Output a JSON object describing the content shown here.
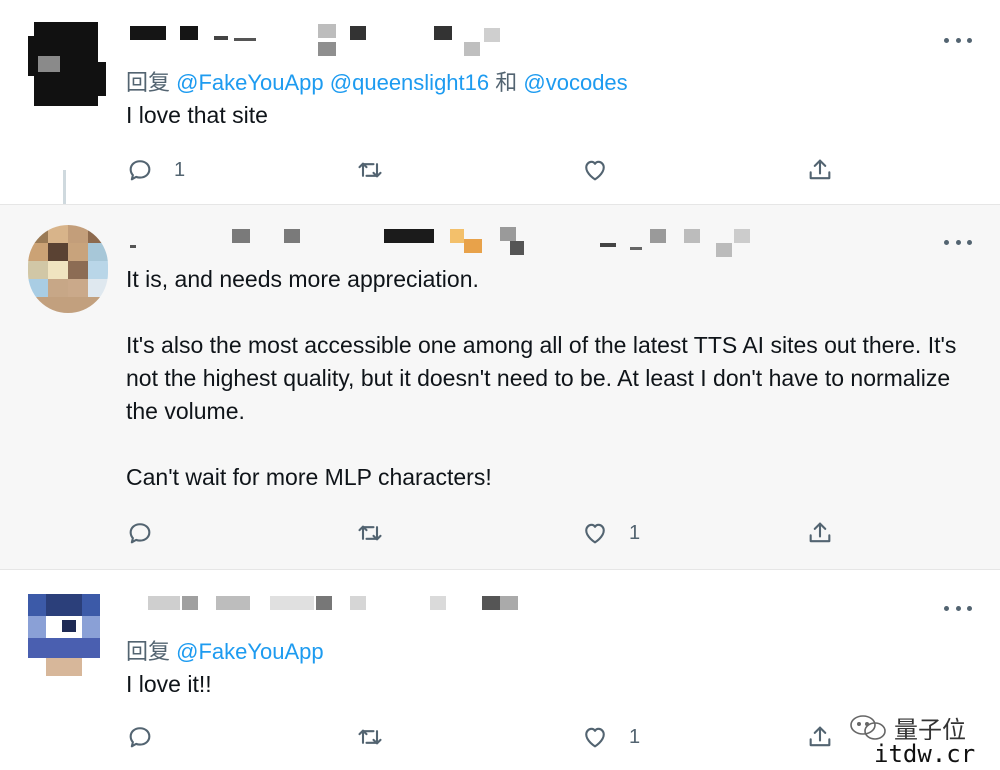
{
  "tweets": [
    {
      "reply_prefix": "回复",
      "mentions": [
        "@FakeYouApp",
        "@queenslight16"
      ],
      "joiner": "和",
      "last_mention": "@vocodes",
      "body": [
        "I love that site"
      ],
      "reply_count": "1",
      "retweet_count": "",
      "like_count": ""
    },
    {
      "body": [
        "It is, and needs more appreciation.",
        "It's also the most accessible one among all of the latest TTS AI sites out there. It's not the highest quality, but it doesn't need to be. At least I don't have to normalize the volume.",
        "Can't wait for more MLP characters!"
      ],
      "reply_count": "",
      "retweet_count": "",
      "like_count": "1"
    },
    {
      "reply_prefix": "回复",
      "mentions": [
        "@FakeYouApp"
      ],
      "body": [
        "I love it!!"
      ],
      "reply_count": "",
      "retweet_count": "",
      "like_count": "1"
    }
  ],
  "icons": {
    "reply": "reply-icon",
    "retweet": "retweet-icon",
    "like": "heart-icon",
    "share": "share-icon",
    "more": "more-options-icon"
  },
  "watermark": {
    "brand": "量子位",
    "site": "itdw.cr"
  },
  "colors": {
    "accent": "#1d9bf0",
    "muted": "#536471",
    "text": "#0f1419",
    "highlight_bg": "#f7f7f7"
  }
}
